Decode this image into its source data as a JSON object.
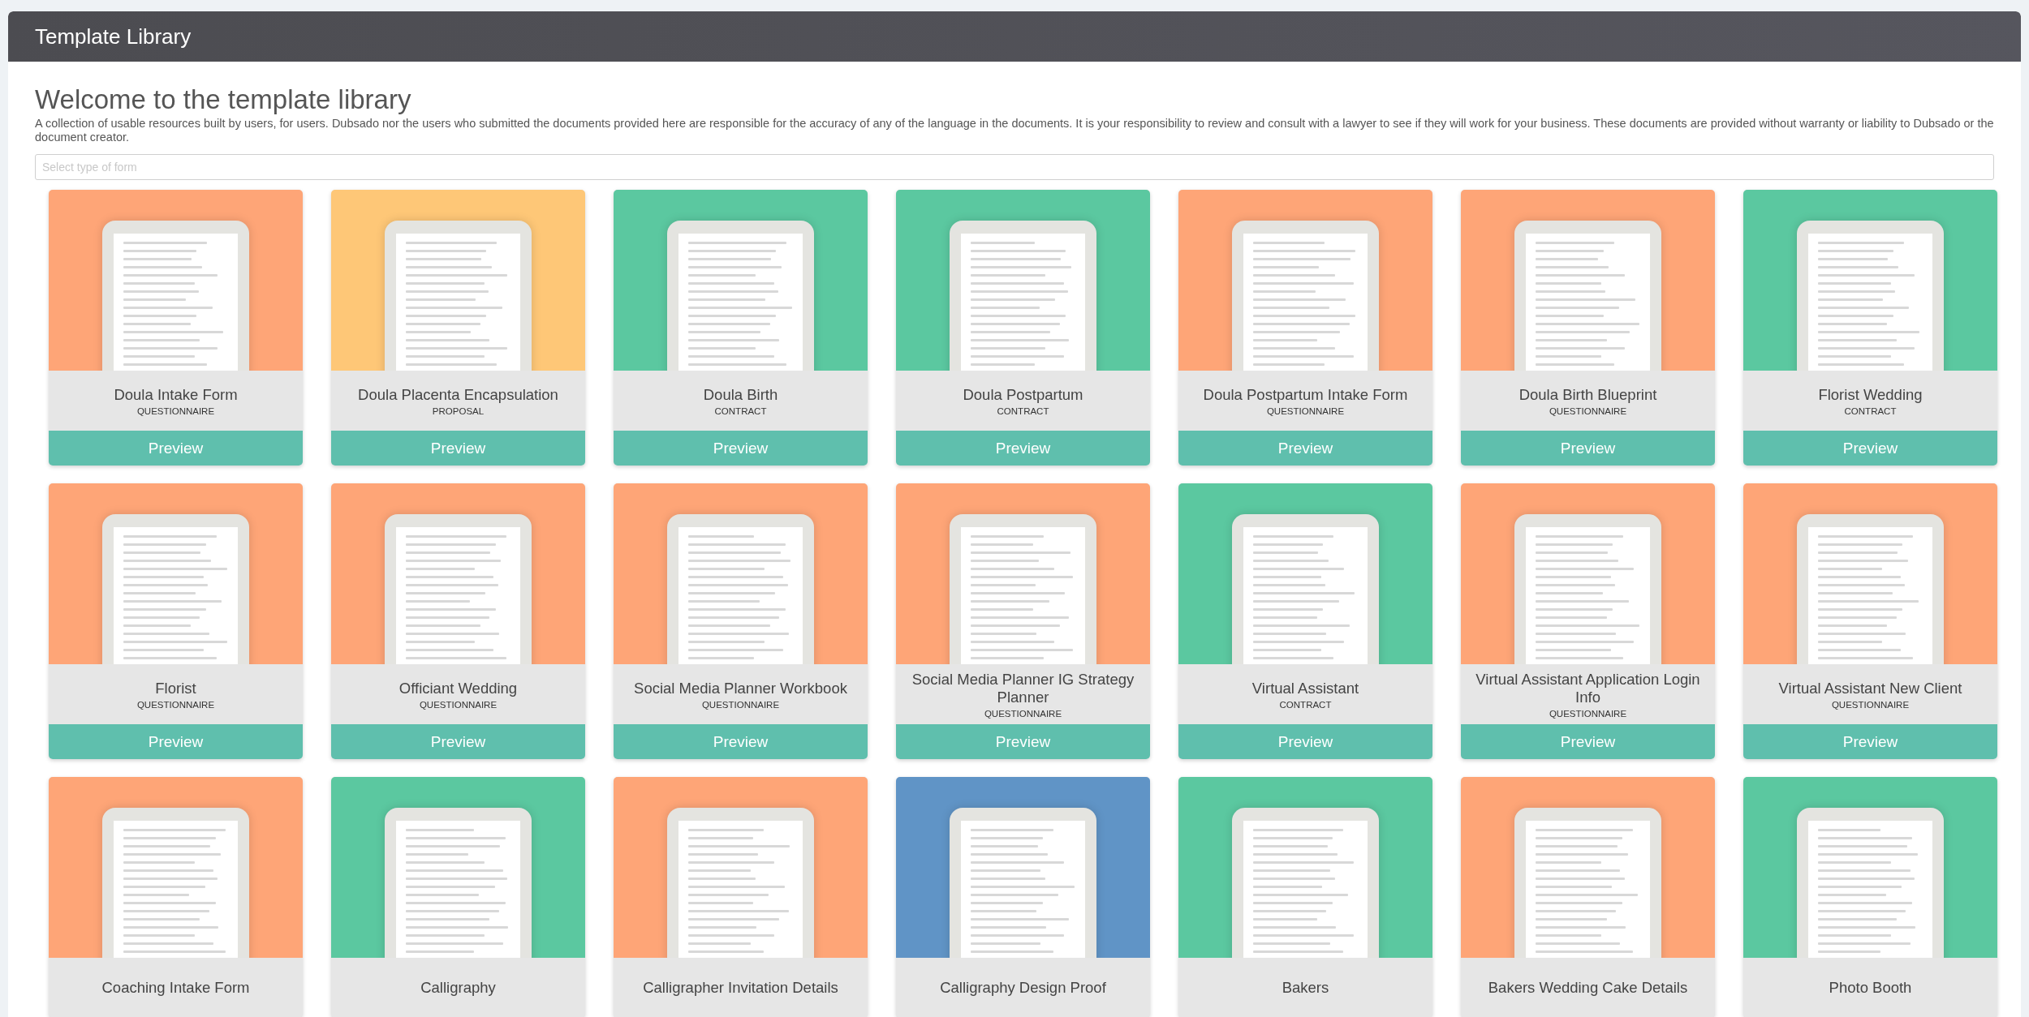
{
  "header": {
    "title": "Template Library"
  },
  "intro": {
    "heading": "Welcome to the template library",
    "description": "A collection of usable resources built by users, for users. Dubsado nor the users who submitted the documents provided here are responsible for the accuracy of any of the language in the documents. It is your responsibility to review and consult with a lawyer to see if they will work for your business. These documents are provided without warranty or liability to Dubsado or the document creator."
  },
  "filter": {
    "placeholder": "Select type of form"
  },
  "templates": [
    {
      "title": "Doula Intake Form",
      "type": "QUESTIONNAIRE",
      "color": "#fea577",
      "button": "Preview"
    },
    {
      "title": "Doula Placenta Encapsulation",
      "type": "PROPOSAL",
      "color": "#fec777",
      "button": "Preview"
    },
    {
      "title": "Doula Birth",
      "type": "CONTRACT",
      "color": "#5bc8a0",
      "button": "Preview"
    },
    {
      "title": "Doula Postpartum",
      "type": "CONTRACT",
      "color": "#5bc8a0",
      "button": "Preview"
    },
    {
      "title": "Doula Postpartum Intake Form",
      "type": "QUESTIONNAIRE",
      "color": "#fea577",
      "button": "Preview"
    },
    {
      "title": "Doula Birth Blueprint",
      "type": "QUESTIONNAIRE",
      "color": "#fea577",
      "button": "Preview"
    },
    {
      "title": "Florist Wedding",
      "type": "CONTRACT",
      "color": "#5bc8a0",
      "button": "Preview"
    },
    {
      "title": "Florist",
      "type": "QUESTIONNAIRE",
      "color": "#fea577",
      "button": "Preview"
    },
    {
      "title": "Officiant Wedding",
      "type": "QUESTIONNAIRE",
      "color": "#fea577",
      "button": "Preview"
    },
    {
      "title": "Social Media Planner Workbook",
      "type": "QUESTIONNAIRE",
      "color": "#fea577",
      "button": "Preview"
    },
    {
      "title": "Social Media Planner IG Strategy Planner",
      "type": "QUESTIONNAIRE",
      "color": "#fea577",
      "button": "Preview"
    },
    {
      "title": "Virtual Assistant",
      "type": "CONTRACT",
      "color": "#5bc8a0",
      "button": "Preview"
    },
    {
      "title": "Virtual Assistant Application Login Info",
      "type": "QUESTIONNAIRE",
      "color": "#fea577",
      "button": "Preview"
    },
    {
      "title": "Virtual Assistant New Client",
      "type": "QUESTIONNAIRE",
      "color": "#fea577",
      "button": "Preview"
    },
    {
      "title": "Coaching Intake Form",
      "color": "#fea577"
    },
    {
      "title": "Calligraphy",
      "color": "#5bc8a0"
    },
    {
      "title": "Calligrapher Invitation Details",
      "color": "#fea577"
    },
    {
      "title": "Calligraphy Design Proof",
      "color": "#6094c6"
    },
    {
      "title": "Bakers",
      "color": "#5bc8a0"
    },
    {
      "title": "Bakers Wedding Cake Details",
      "color": "#fea577"
    },
    {
      "title": "Photo Booth",
      "color": "#5bc8a0"
    }
  ]
}
